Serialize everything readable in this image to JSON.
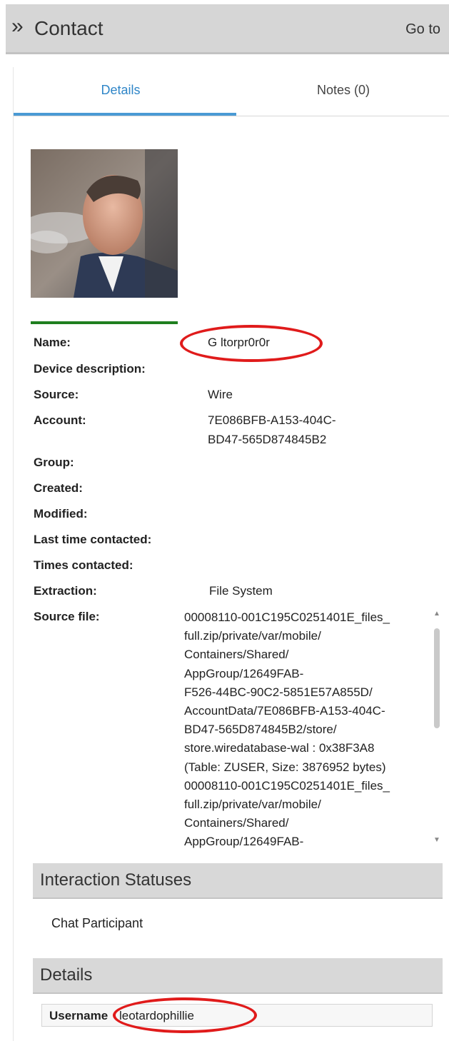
{
  "header": {
    "title": "Contact",
    "goto": "Go to"
  },
  "tabs": {
    "details": "Details",
    "notes": "Notes (0)"
  },
  "fields": {
    "name_label": "Name:",
    "name_value": "G ltorpr0r0r",
    "device_label": "Device description:",
    "source_label": "Source:",
    "source_value": "Wire",
    "account_label": "Account:",
    "account_value_1": "7E086BFB-A153-404C-",
    "account_value_2": "BD47-565D874845B2",
    "group_label": "Group:",
    "created_label": "Created:",
    "modified_label": "Modified:",
    "last_contacted_label": "Last time contacted:",
    "times_contacted_label": "Times contacted:",
    "extraction_label": "Extraction:",
    "extraction_value": "File System",
    "source_file_label": "Source file:"
  },
  "source_file_lines": [
    "00008110-001C195C0251401E_files_",
    "full.zip/private/var/mobile/",
    "Containers/Shared/",
    "AppGroup/12649FAB-",
    "F526-44BC-90C2-5851E57A855D/",
    "AccountData/7E086BFB-A153-404C-",
    "BD47-565D874845B2/store/",
    "store.wiredatabase-wal : 0x38F3A8",
    "(Table: ZUSER, Size: 3876952 bytes)",
    "00008110-001C195C0251401E_files_",
    "full.zip/private/var/mobile/",
    "Containers/Shared/",
    "AppGroup/12649FAB-"
  ],
  "interaction": {
    "title": "Interaction Statuses",
    "item": "Chat Participant"
  },
  "details_section": {
    "title": "Details",
    "username_label": "Username",
    "username_value": "leotardophillie"
  },
  "colors": {
    "tab_active": "#2f86c8",
    "annotation": "#e01b1b",
    "photo_bar": "#1f7f1f",
    "header_bg": "#d6d6d6"
  },
  "icons": {
    "header": "double-chevron-right-icon",
    "scroll_up": "triangle-up-icon",
    "scroll_down": "triangle-down-icon"
  }
}
